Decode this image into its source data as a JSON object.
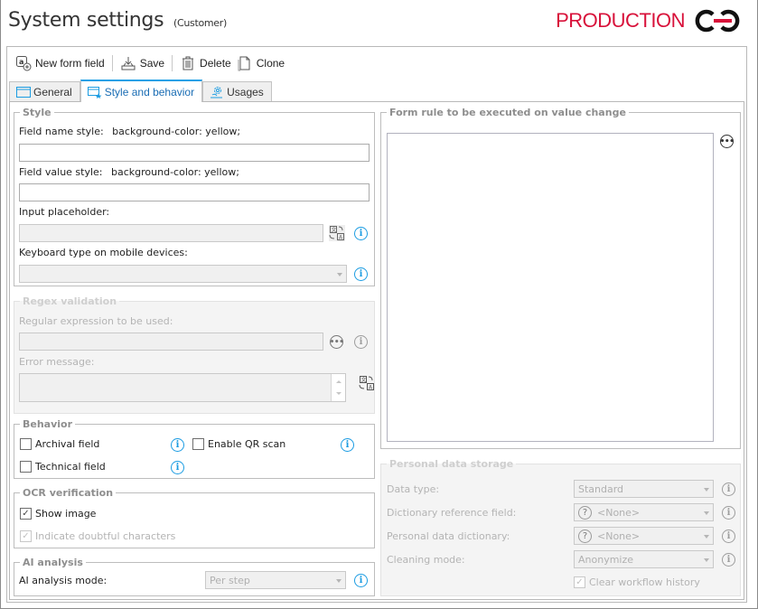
{
  "header": {
    "title": "System settings",
    "subtitle": "(Customer)",
    "environment_badge": "PRODUCTION",
    "brand_color": "#d8113a"
  },
  "toolbar": {
    "new_form_field": "New form field",
    "save": "Save",
    "delete": "Delete",
    "clone": "Clone"
  },
  "tabs": [
    {
      "label": "General",
      "active": false
    },
    {
      "label": "Style and behavior",
      "active": true
    },
    {
      "label": "Usages",
      "active": false
    }
  ],
  "style_group": {
    "legend": "Style",
    "field_name_style_label": "Field name style:",
    "field_name_style_value": "background-color: yellow;",
    "field_name_input": "",
    "field_value_style_label": "Field value style:",
    "field_value_style_value": "background-color: yellow;",
    "field_value_input": "",
    "input_placeholder_label": "Input placeholder:",
    "input_placeholder_value": "",
    "keyboard_type_label": "Keyboard type on mobile devices:",
    "keyboard_type_value": ""
  },
  "regex_group": {
    "legend": "Regex validation",
    "regex_label": "Regular expression to be used:",
    "regex_value": "",
    "error_message_label": "Error message:",
    "error_message_value": ""
  },
  "behavior_group": {
    "legend": "Behavior",
    "archival_field": {
      "label": "Archival field",
      "checked": false
    },
    "enable_qr_scan": {
      "label": "Enable QR scan",
      "checked": false
    },
    "technical_field": {
      "label": "Technical field",
      "checked": false
    }
  },
  "ocr_group": {
    "legend": "OCR verification",
    "show_image": {
      "label": "Show image",
      "checked": true
    },
    "indicate_doubtful": {
      "label": "Indicate doubtful characters",
      "checked": true,
      "disabled": true
    }
  },
  "ai_group": {
    "legend": "AI analysis",
    "mode_label": "AI analysis mode:",
    "mode_value": "Per step"
  },
  "form_rule_group": {
    "legend": "Form rule to be executed on value change",
    "value": ""
  },
  "personal_data_group": {
    "legend": "Personal data storage",
    "data_type_label": "Data type:",
    "data_type_value": "Standard",
    "dictionary_ref_label": "Dictionary reference field:",
    "dictionary_ref_value": "<None>",
    "personal_dict_label": "Personal data dictionary:",
    "personal_dict_value": "<None>",
    "cleaning_mode_label": "Cleaning mode:",
    "cleaning_mode_value": "Anonymize",
    "clear_history": {
      "label": "Clear workflow history",
      "checked": true,
      "disabled": true
    }
  },
  "icons": {
    "info": "i",
    "help": "?",
    "more": "•••",
    "check": "✓"
  }
}
